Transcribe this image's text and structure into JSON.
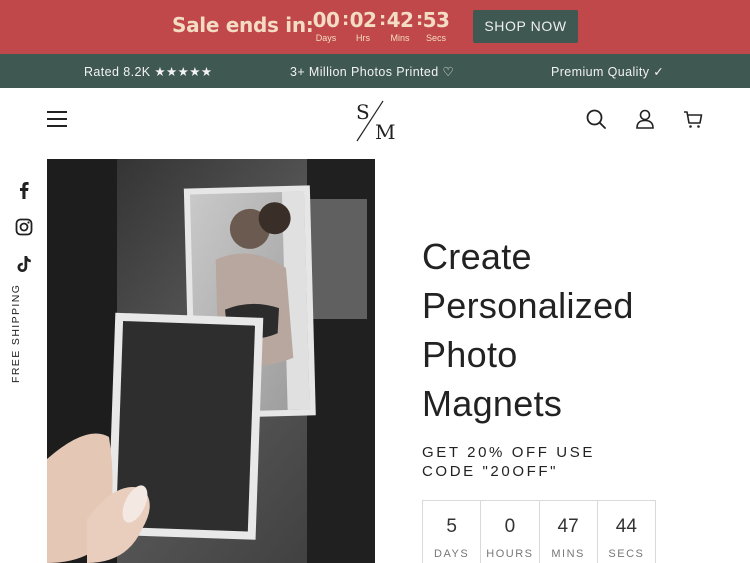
{
  "sale_bar": {
    "label": "Sale ends in:",
    "countdown": [
      {
        "value": "00",
        "unit": "Days"
      },
      {
        "value": "02",
        "unit": "Hrs"
      },
      {
        "value": "42",
        "unit": "Mins"
      },
      {
        "value": "53",
        "unit": "Secs"
      }
    ],
    "separator": ":",
    "button_label": "SHOP NOW",
    "bg_color": "#c0474a",
    "text_color": "#f3dcc3",
    "button_color": "#3f5852"
  },
  "announcement": {
    "items": [
      "Rated 8.2K ★★★★★",
      "3+ Million Photos Printed ♡",
      "Premium Quality ✓"
    ],
    "bg_color": "#3f5852"
  },
  "header": {
    "logo_text": "SM",
    "icons": [
      "menu-icon",
      "search-icon",
      "account-icon",
      "cart-icon"
    ]
  },
  "sidebar": {
    "social_icons": [
      "facebook-icon",
      "instagram-icon",
      "tiktok-icon"
    ],
    "free_shipping": "FREE SHIPPING"
  },
  "hero": {
    "title_lines": [
      "Create",
      "Personalized",
      "Photo",
      "Magnets"
    ],
    "promo_lines": [
      "GET 20% OFF USE",
      "CODE \"20OFF\""
    ],
    "timer": [
      {
        "value": "5",
        "unit": "DAYS"
      },
      {
        "value": "0",
        "unit": "HOURS"
      },
      {
        "value": "47",
        "unit": "MINS"
      },
      {
        "value": "44",
        "unit": "SECS"
      }
    ]
  }
}
